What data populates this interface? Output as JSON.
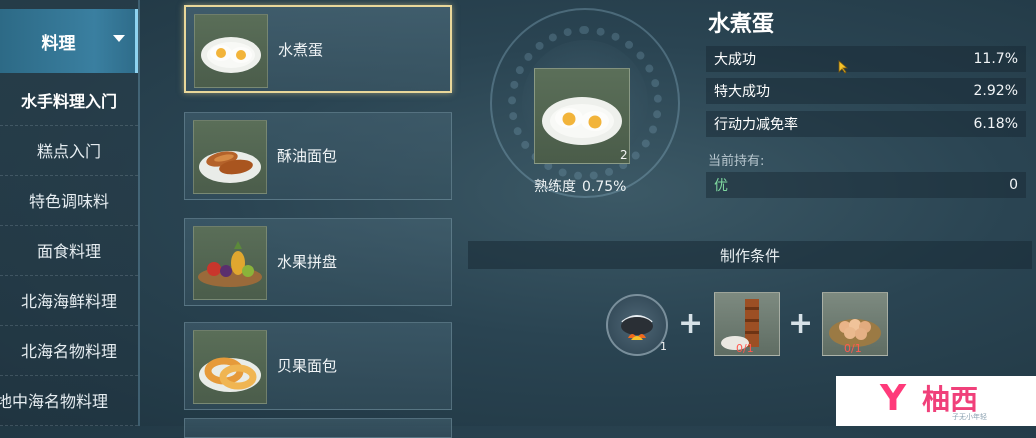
{
  "sidebar": {
    "header_label": "料理",
    "items": [
      {
        "label": "水手料理入门",
        "active": true
      },
      {
        "label": "糕点入门"
      },
      {
        "label": "特色调味料"
      },
      {
        "label": "面食料理"
      },
      {
        "label": "北海海鲜料理"
      },
      {
        "label": "北海名物料理"
      },
      {
        "label": "地中海名物料理"
      }
    ]
  },
  "recipes": [
    {
      "name": "水煮蛋",
      "icon": "boiled-egg-icon",
      "selected": true
    },
    {
      "name": "酥油面包",
      "icon": "butter-bread-icon"
    },
    {
      "name": "水果拼盘",
      "icon": "fruit-platter-icon"
    },
    {
      "name": "贝果面包",
      "icon": "bagel-icon"
    }
  ],
  "preview": {
    "quantity": "2",
    "proficiency_label": "熟练度",
    "proficiency_value": "0.75%"
  },
  "detail": {
    "title": "水煮蛋",
    "stats": [
      {
        "label": "大成功",
        "value": "11.7%"
      },
      {
        "label": "特大成功",
        "value": "2.92%"
      },
      {
        "label": "行动力减免率",
        "value": "6.18%"
      }
    ],
    "holding_label": "当前持有:",
    "grade": {
      "label": "优",
      "value": "0"
    }
  },
  "crafting": {
    "title": "制作条件",
    "ingredients": [
      {
        "icon": "cooking-pot-icon",
        "count": "1",
        "shape": "round"
      },
      {
        "icon": "flour-icon",
        "count": "0/1",
        "shape": "square"
      },
      {
        "icon": "eggs-basket-icon",
        "count": "0/1",
        "shape": "square"
      }
    ]
  },
  "watermark": {
    "brand": "柚西",
    "subtitle": "子无小年轻"
  },
  "colors": {
    "accent": "#8fd3f0",
    "selected_border": "#e9d79a",
    "grade": "#7fd9a0",
    "missing": "#ff5a4f"
  }
}
